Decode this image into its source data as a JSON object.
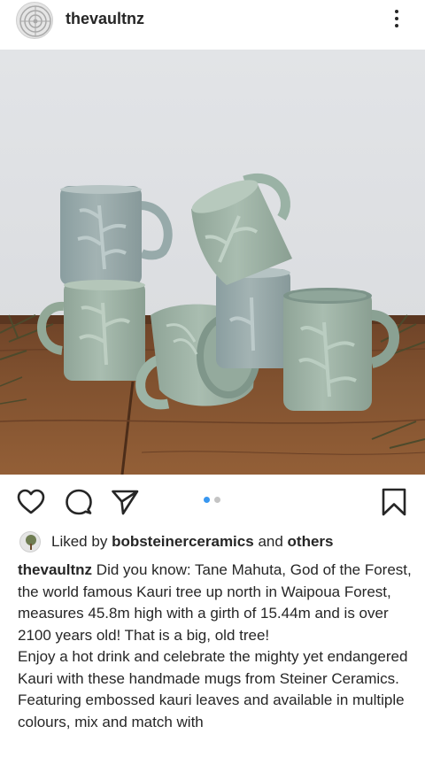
{
  "post": {
    "username": "thevaultnz",
    "liked_by_label": "Liked by",
    "liked_by_user": "bobsteinerceramics",
    "and_label": "and",
    "others_label": "others",
    "caption_username": "thevaultnz",
    "caption_text": "Did you know: Tane Mahuta, God of the Forest, the world famous Kauri tree up north in Waipoua Forest, measures 45.8m high with a girth of 15.44m and is over 2100 years old! That is a big, old tree!",
    "caption_text_2": "Enjoy a hot drink and celebrate the mighty yet endangered Kauri with these handmade mugs from Steiner Ceramics. Featuring embossed kauri leaves and available in multiple colours, mix and match with"
  },
  "carousel": {
    "current": 1,
    "total": 2
  },
  "icons": {
    "header_more": "more-vertical-icon",
    "like": "heart-icon",
    "comment": "comment-icon",
    "share": "send-icon",
    "save": "bookmark-icon"
  },
  "colors": {
    "accent_dot": "#3897f0",
    "inactive_dot": "#c4c4c4",
    "mug_celadon": "#a3b8aa"
  }
}
